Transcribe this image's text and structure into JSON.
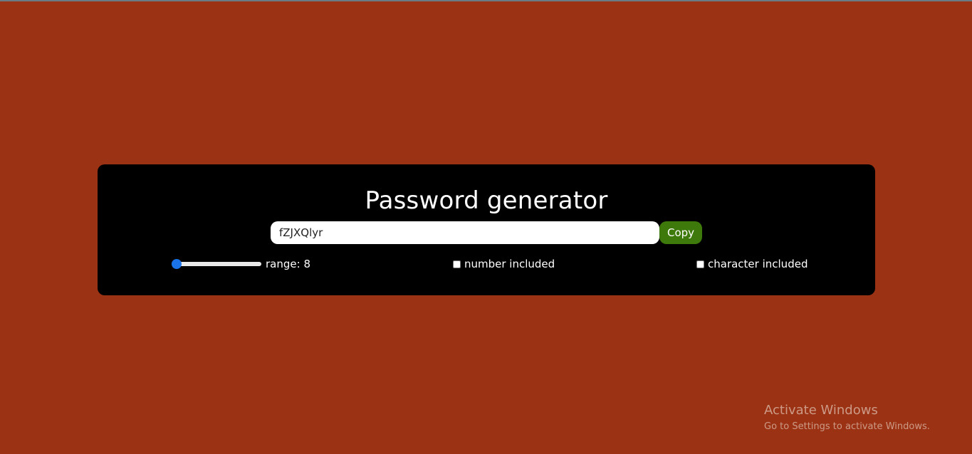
{
  "app": {
    "title": "Password generator"
  },
  "password": {
    "value": "fZJXQlyr"
  },
  "copy_button": {
    "label": "Copy"
  },
  "length_slider": {
    "label": "range: 8",
    "value": 8,
    "level_fraction": 0.0
  },
  "options": {
    "number_label": "number included",
    "number_checked": false,
    "character_label": "character included",
    "character_checked": false
  },
  "watermark": {
    "title": "Activate Windows",
    "subtitle": "Go to Settings to activate Windows."
  },
  "colors": {
    "background": "#9b3213",
    "card": "#000000",
    "copy_button": "#3e7a0b",
    "slider_accent": "#1a73e8"
  }
}
